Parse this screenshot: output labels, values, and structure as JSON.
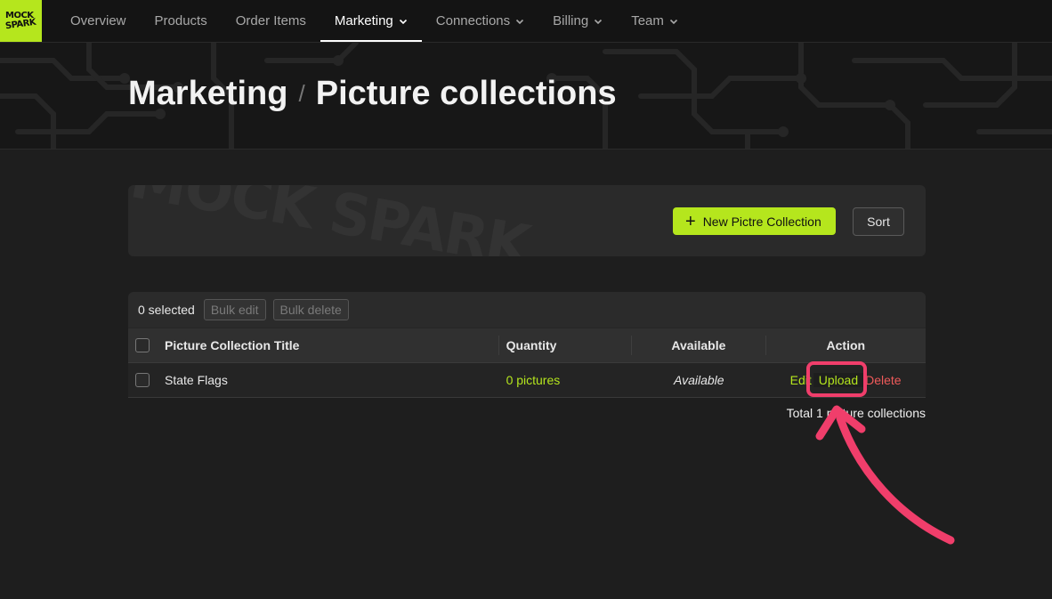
{
  "brand": {
    "logo_line1": "MOCK",
    "logo_line2": "SPARK",
    "accent": "#b5e61d"
  },
  "nav": {
    "items": [
      {
        "label": "Overview",
        "dropdown": false,
        "active": false
      },
      {
        "label": "Products",
        "dropdown": false,
        "active": false
      },
      {
        "label": "Order Items",
        "dropdown": false,
        "active": false
      },
      {
        "label": "Marketing",
        "dropdown": true,
        "active": true
      },
      {
        "label": "Connections",
        "dropdown": true,
        "active": false
      },
      {
        "label": "Billing",
        "dropdown": true,
        "active": false
      },
      {
        "label": "Team",
        "dropdown": true,
        "active": false
      }
    ]
  },
  "header": {
    "section": "Marketing",
    "separator": "/",
    "title": "Picture collections"
  },
  "toolbar": {
    "watermark": "MOCK SPARK",
    "new_label": "New Pictre Collection",
    "sort_label": "Sort"
  },
  "table": {
    "selected_count": "0 selected",
    "bulk_edit": "Bulk edit",
    "bulk_delete": "Bulk delete",
    "columns": {
      "title": "Picture Collection Title",
      "quantity": "Quantity",
      "available": "Available",
      "action": "Action"
    },
    "rows": [
      {
        "title": "State Flags",
        "quantity": "0 pictures",
        "available": "Available",
        "actions": {
          "edit": "Edit",
          "upload": "Upload",
          "delete": "Delete"
        }
      }
    ],
    "total": "Total 1 picture collections"
  },
  "annotation": {
    "color": "#f03e6b"
  }
}
